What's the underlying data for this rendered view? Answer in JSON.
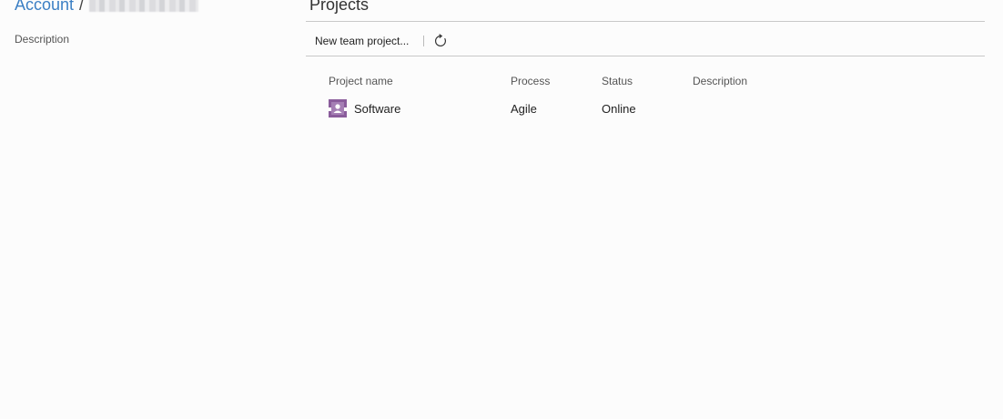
{
  "breadcrumb": {
    "account": "Account",
    "separator": "/"
  },
  "left": {
    "description_label": "Description"
  },
  "projects": {
    "title": "Projects",
    "toolbar": {
      "new_label": "New team project...",
      "refresh_icon": "refresh-icon"
    },
    "columns": [
      "Project name",
      "Process",
      "Status",
      "Description"
    ],
    "rows": [
      {
        "icon": "team-project-icon",
        "name": "Software",
        "process": "Agile",
        "status": "Online",
        "description": ""
      }
    ]
  },
  "colors": {
    "accent": "#3b7fc4",
    "project_icon": "#8a5c9b"
  }
}
